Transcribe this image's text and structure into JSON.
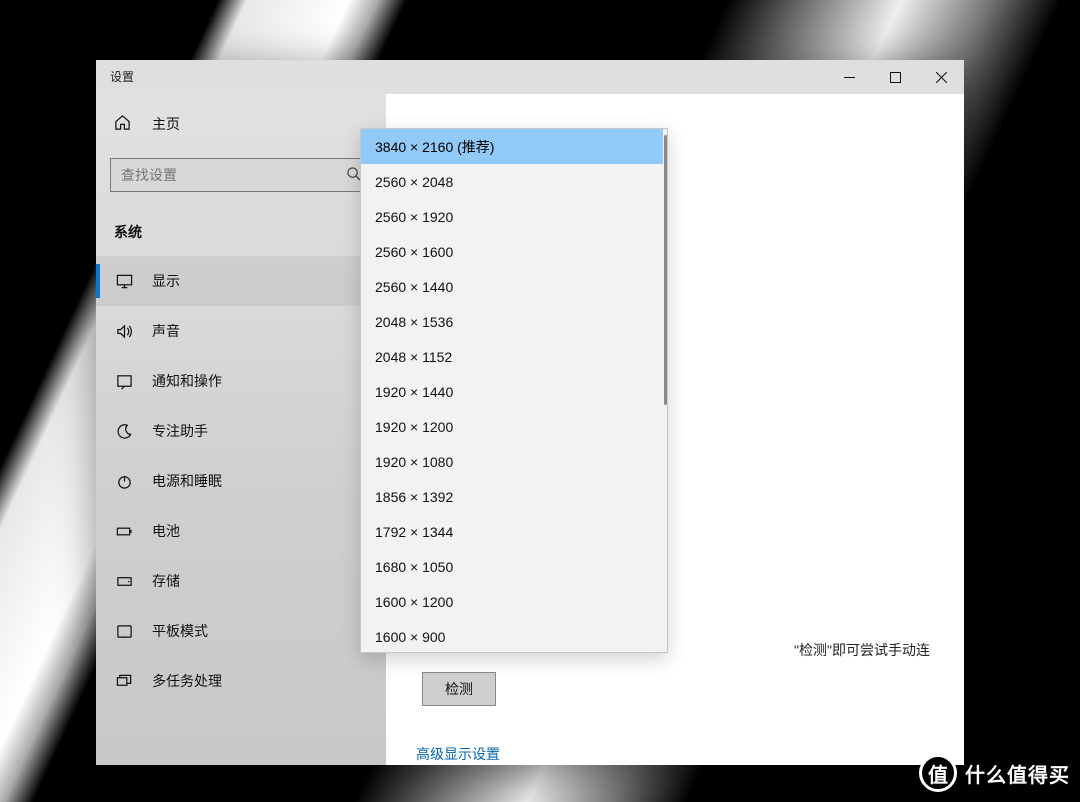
{
  "window": {
    "title": "设置",
    "minimize_label": "Minimize",
    "maximize_label": "Maximize",
    "close_label": "Close"
  },
  "sidebar": {
    "home_label": "主页",
    "search_placeholder": "查找设置",
    "section_label": "系统",
    "items": [
      {
        "label": "显示",
        "icon": "monitor"
      },
      {
        "label": "声音",
        "icon": "sound"
      },
      {
        "label": "通知和操作",
        "icon": "notification"
      },
      {
        "label": "专注助手",
        "icon": "moon"
      },
      {
        "label": "电源和睡眠",
        "icon": "power"
      },
      {
        "label": "电池",
        "icon": "battery"
      },
      {
        "label": "存储",
        "icon": "storage"
      },
      {
        "label": "平板模式",
        "icon": "tablet"
      },
      {
        "label": "多任务处理",
        "icon": "multitask"
      }
    ],
    "active_index": 0
  },
  "content": {
    "hint_text": "\"检测\"即可尝试手动连",
    "detect_button": "检测",
    "advanced_link": "高级显示设置"
  },
  "resolution_dropdown": {
    "selected_index": 0,
    "options": [
      "3840 × 2160 (推荐)",
      "2560 × 2048",
      "2560 × 1920",
      "2560 × 1600",
      "2560 × 1440",
      "2048 × 1536",
      "2048 × 1152",
      "1920 × 1440",
      "1920 × 1200",
      "1920 × 1080",
      "1856 × 1392",
      "1792 × 1344",
      "1680 × 1050",
      "1600 × 1200",
      "1600 × 900"
    ]
  },
  "watermark": {
    "badge": "值",
    "text": "什么值得买"
  }
}
